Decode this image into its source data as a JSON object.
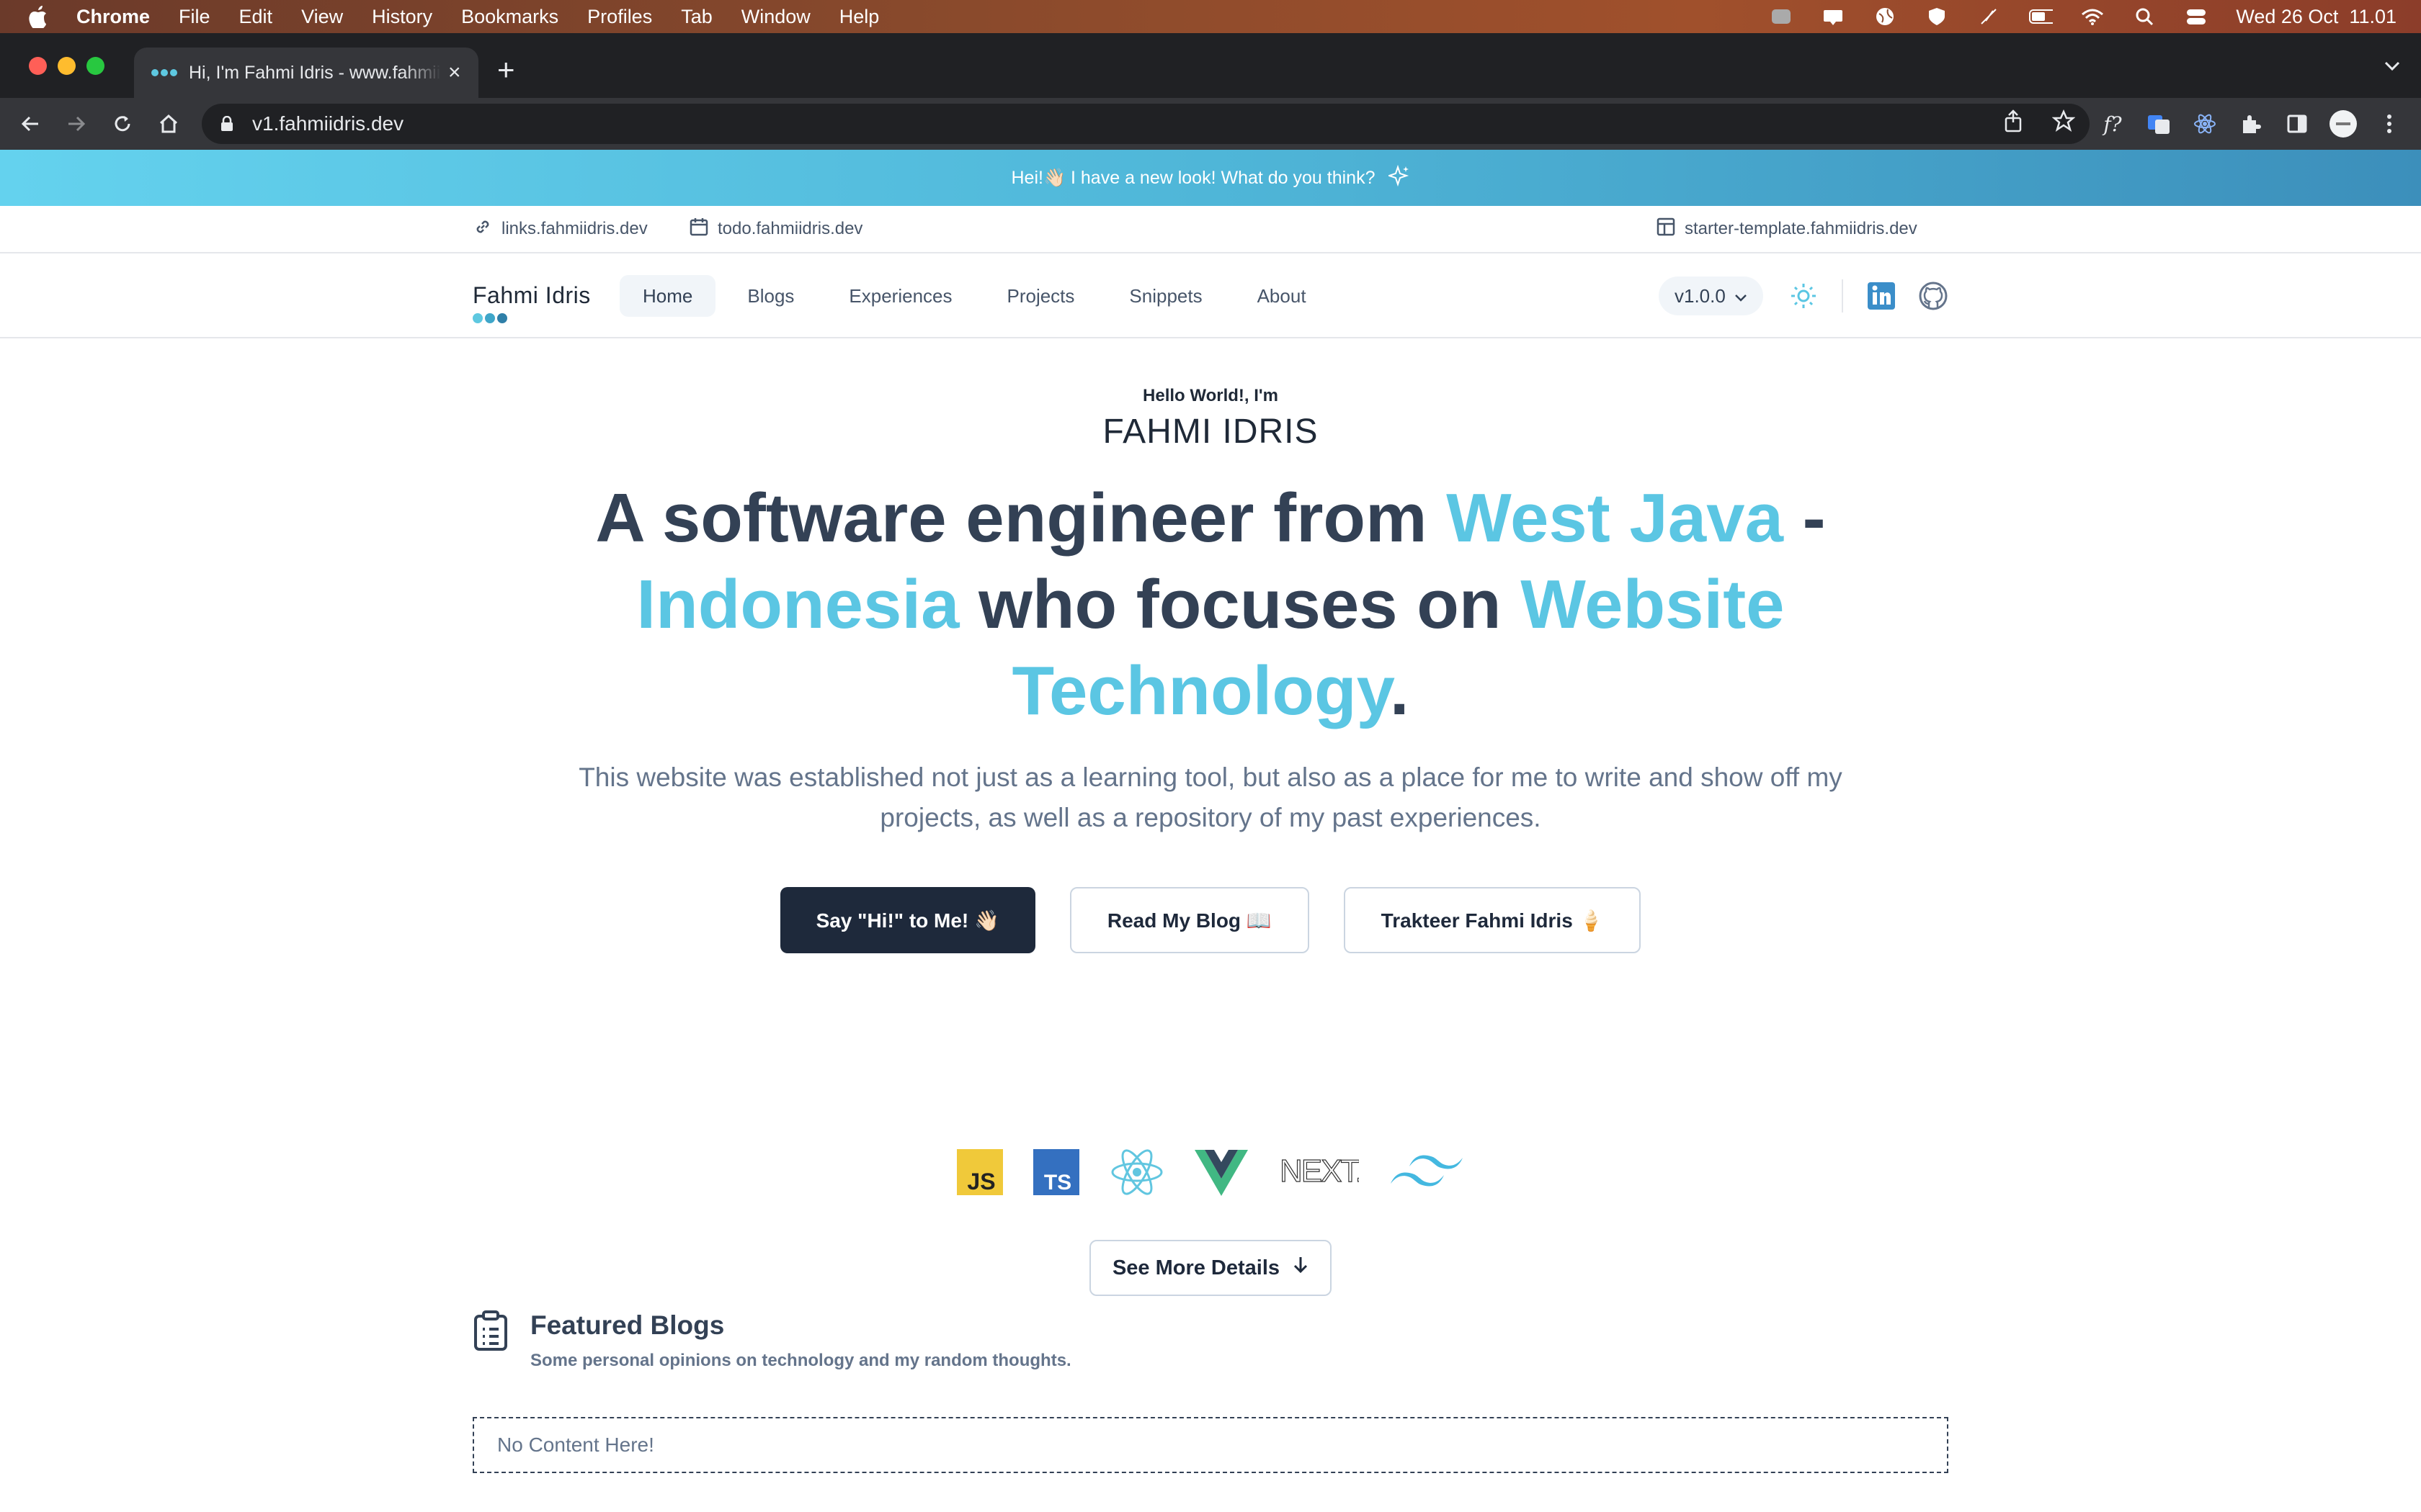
{
  "menubar": {
    "app": "Chrome",
    "items": [
      "File",
      "Edit",
      "View",
      "History",
      "Bookmarks",
      "Profiles",
      "Tab",
      "Window",
      "Help"
    ],
    "clock": "Wed 26 Oct  11.01"
  },
  "browser": {
    "tab_title": "Hi, I'm Fahmi Idris - www.fahmiidris.dev",
    "url": "v1.fahmiidris.dev"
  },
  "site": {
    "announcement": "Hei!👋🏻 I have a new look! What do you think?",
    "links": {
      "links": "links.fahmiidris.dev",
      "todo": "todo.fahmiidris.dev",
      "starter": "starter-template.fahmiidris.dev"
    },
    "brand": "Fahmi Idris",
    "nav": [
      "Home",
      "Blogs",
      "Experiences",
      "Projects",
      "Snippets",
      "About"
    ],
    "version": "v1.0.0",
    "colors": {
      "accent": "#5bc6e3",
      "dark": "#1e293b",
      "text": "#334155"
    }
  },
  "hero": {
    "hello": "Hello World!, I'm",
    "name": "FAHMI IDRIS",
    "headline": {
      "p1": "A software engineer from ",
      "h1": "West Java",
      "p2": " - ",
      "h2": "Indonesia",
      "p3": " who focuses on ",
      "h3": "Website Technology",
      "p4": "."
    },
    "description": "This website was established not just as a learning tool, but also as a place for me to write and show off my projects, as well as a repository of my past experiences.",
    "cta_primary": "Say \"Hi!\" to Me! 👋🏻",
    "cta_blog": "Read My Blog 📖",
    "cta_trakteer": "Trakteer Fahmi Idris 🍦",
    "tech_icons": [
      "javascript-icon",
      "typescript-icon",
      "react-icon",
      "vue-icon",
      "nextjs-icon",
      "tailwind-icon"
    ],
    "nextjs_label": "NEXT.js",
    "see_more": "See More Details"
  },
  "featured": {
    "title": "Featured Blogs",
    "subtitle": "Some personal opinions on technology and my random thoughts.",
    "empty": "No Content Here!"
  }
}
